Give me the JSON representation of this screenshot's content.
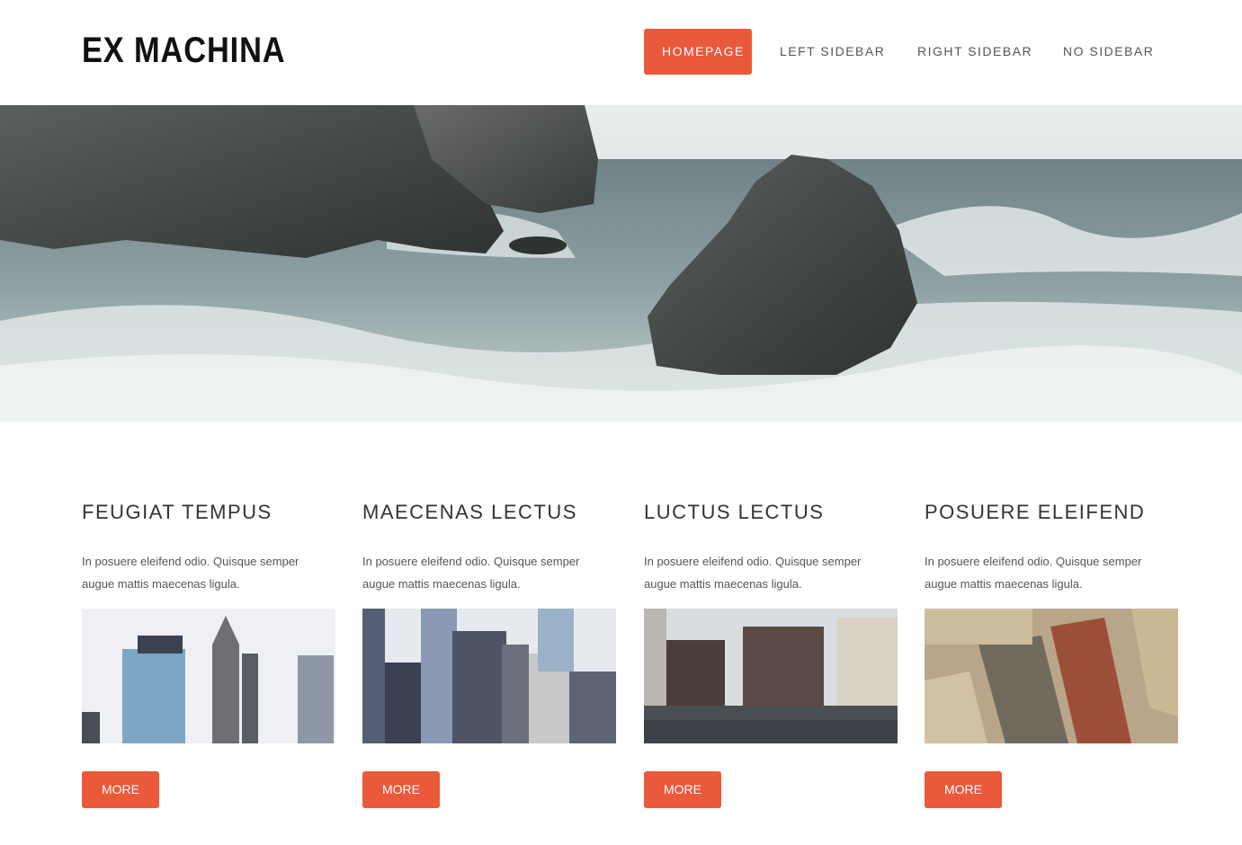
{
  "header": {
    "logo": "EX MACHINA",
    "nav": [
      {
        "label": "HOMEPAGE",
        "active": true
      },
      {
        "label": "LEFT SIDEBAR",
        "active": false
      },
      {
        "label": "RIGHT SIDEBAR",
        "active": false
      },
      {
        "label": "NO SIDEBAR",
        "active": false
      }
    ]
  },
  "colors": {
    "accent": "#e9593a"
  },
  "cards": [
    {
      "title": "FEUGIAT TEMPUS",
      "text": "In posuere eleifend odio. Quisque semper augue mattis maecenas ligula.",
      "button": "MORE"
    },
    {
      "title": "MAECENAS LECTUS",
      "text": "In posuere eleifend odio. Quisque semper augue mattis maecenas ligula.",
      "button": "MORE"
    },
    {
      "title": "LUCTUS LECTUS",
      "text": "In posuere eleifend odio. Quisque semper augue mattis maecenas ligula.",
      "button": "MORE"
    },
    {
      "title": "POSUERE ELEIFEND",
      "text": "In posuere eleifend odio. Quisque semper augue mattis maecenas ligula.",
      "button": "MORE"
    }
  ]
}
